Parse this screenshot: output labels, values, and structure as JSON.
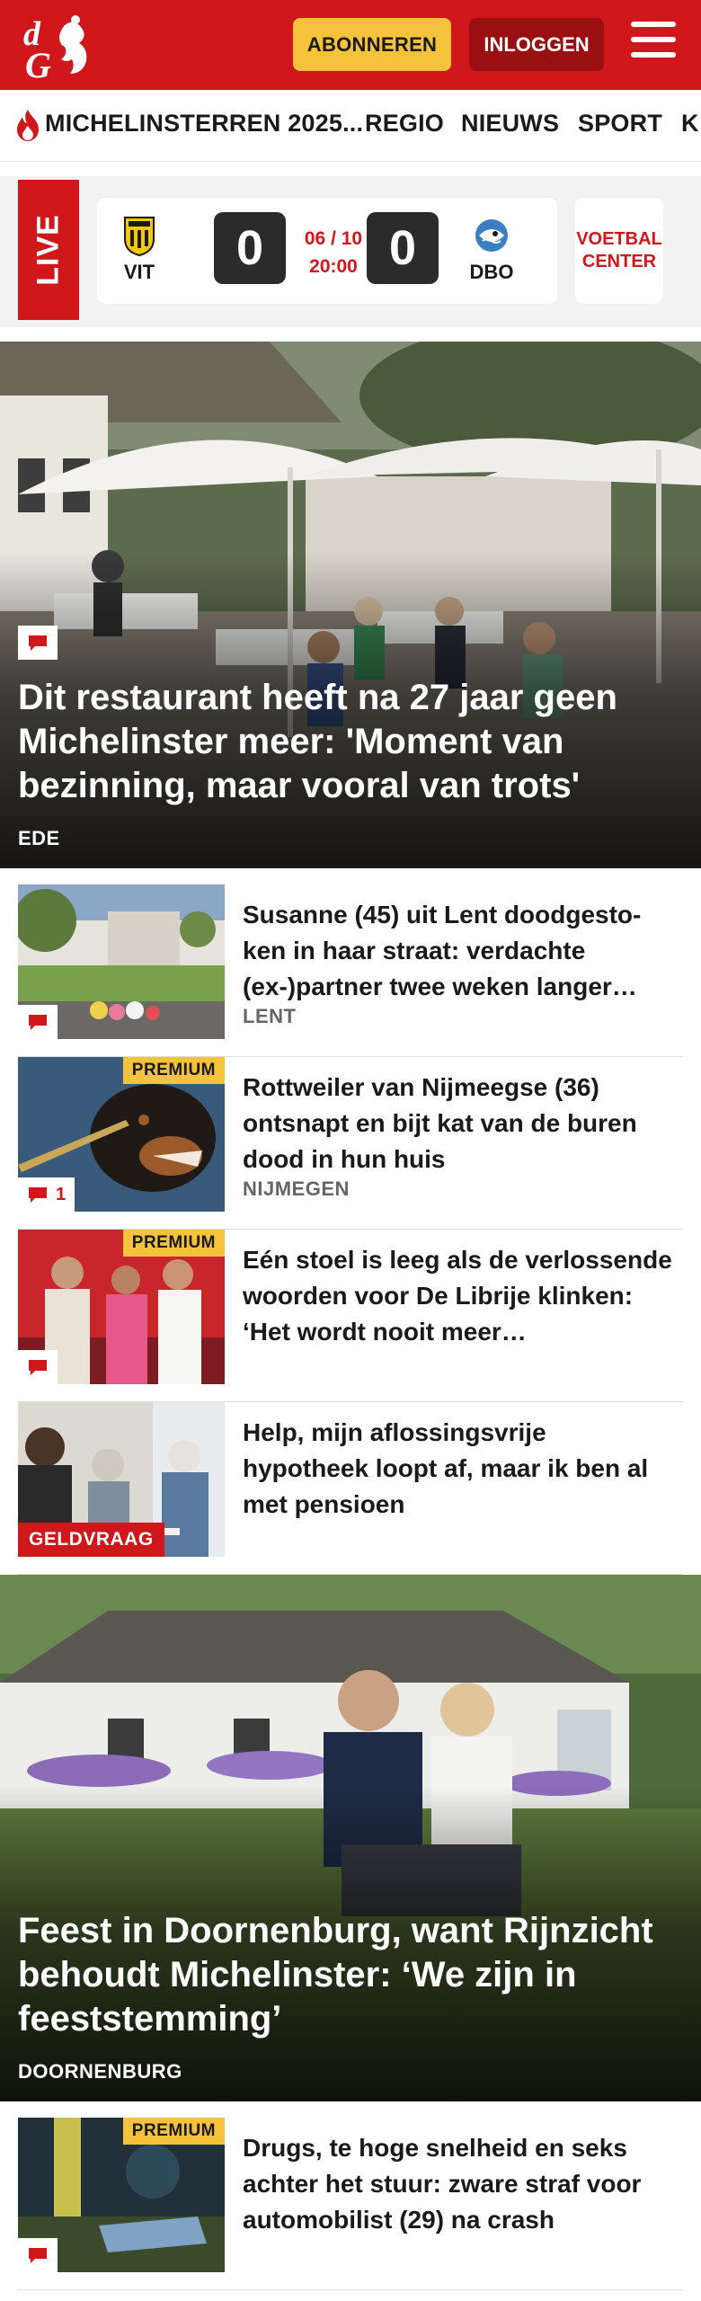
{
  "header": {
    "subscribe_label": "ABONNEREN",
    "login_label": "INLOGGEN",
    "brand_color": "#d0171c",
    "subscribe_color": "#f5c33b"
  },
  "nav": {
    "items": [
      {
        "label": "MICHELINSTERREN 2025...",
        "icon": "flame-icon"
      },
      {
        "label": "REGIO"
      },
      {
        "label": "NIEUWS"
      },
      {
        "label": "SPORT"
      },
      {
        "label": "K"
      }
    ]
  },
  "live": {
    "label": "LIVE",
    "home_team": "VIT",
    "away_team": "DBO",
    "home_score": "0",
    "away_score": "0",
    "date": "06 / 10",
    "time": "20:00",
    "center_label": "VOETBAL CENTER"
  },
  "hero1": {
    "title": "Dit restaurant heeft na 27 jaar geen Michelinster meer: 'Moment van bezinning, maar vooral van trots'",
    "location": "EDE"
  },
  "articles": [
    {
      "title": "Susanne (45) uit Lent doodgesto­ken in haar straat: verdachte (ex-)partner twee weken langer…",
      "location": "LENT",
      "comment_count": ""
    },
    {
      "title": "Rottweiler van Nijmeegse (36) ontsnapt en bijt kat van de buren dood in hun huis",
      "location": "NIJMEGEN",
      "premium_label": "PREMIUM",
      "comment_count": "1"
    },
    {
      "title": "Eén stoel is leeg als de verlossen­de woorden voor De Librije klinken: ‘Het wordt nooit meer…",
      "location": "",
      "premium_label": "PREMIUM",
      "comment_count": ""
    },
    {
      "title": "Help, mijn aflossingsvrije hypotheek loopt af, maar ik ben al met pensioen",
      "location": "",
      "tag_label": "GELDVRAAG"
    }
  ],
  "hero2": {
    "title": "Feest in Doornenburg, want Rijnzicht behoudt Michelinster: ‘We zijn in feeststemming’",
    "location": "DOORNENBURG"
  },
  "article5": {
    "title": "Drugs, te hoge snelheid en seks achter het stuur: zware straf voor automobilist (29) na crash",
    "premium_label": "PREMIUM",
    "comment_count": ""
  }
}
